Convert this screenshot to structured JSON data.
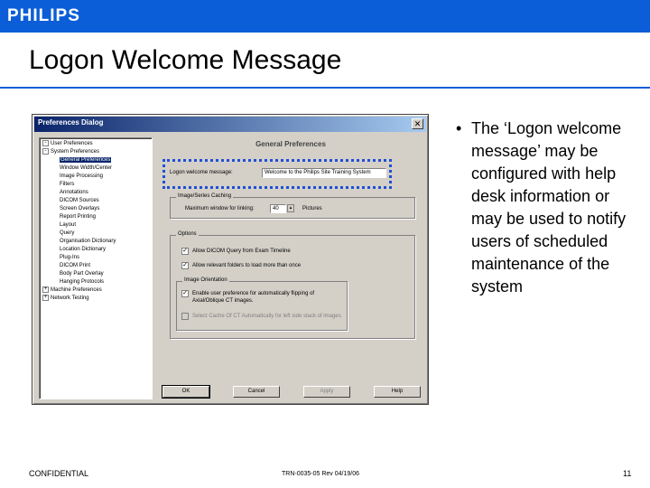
{
  "header": {
    "logo": "PHILIPS"
  },
  "slide": {
    "title": "Logon Welcome Message"
  },
  "dialog": {
    "title": "Preferences Dialog",
    "close_glyph": "✕",
    "tree": [
      {
        "label": "User Preferences",
        "expander": "-",
        "level": 0
      },
      {
        "label": "System Preferences",
        "expander": "-",
        "level": 0
      },
      {
        "label": "General Preferences",
        "level": 2,
        "selected": true
      },
      {
        "label": "Window Width/Center",
        "level": 2
      },
      {
        "label": "Image Processing",
        "level": 2
      },
      {
        "label": "Filters",
        "level": 2
      },
      {
        "label": "Annotations",
        "level": 2
      },
      {
        "label": "DICOM Sources",
        "level": 2
      },
      {
        "label": "Screen Overlays",
        "level": 2
      },
      {
        "label": "Report Printing",
        "level": 2
      },
      {
        "label": "Layout",
        "level": 2
      },
      {
        "label": "Query",
        "level": 2
      },
      {
        "label": "Organisation Dictionary",
        "level": 2
      },
      {
        "label": "Location Dictionary",
        "level": 2
      },
      {
        "label": "Plug-Ins",
        "level": 2
      },
      {
        "label": "DICOM Print",
        "level": 2
      },
      {
        "label": "Body Part Overlay",
        "level": 2
      },
      {
        "label": "Hanging Protocols",
        "level": 2
      },
      {
        "label": "Machine Preferences",
        "expander": "+",
        "level": 0
      },
      {
        "label": "Network Testing",
        "expander": "+",
        "level": 0
      }
    ],
    "panel": {
      "heading": "General Preferences",
      "logon_label": "Logon welcome message:",
      "logon_value": "Welcome to the Philips Site Training System",
      "image_group_title": "Image/Series Caching",
      "max_label": "Maximum window for linking:",
      "max_value": "40",
      "max_unit": "Pictures",
      "options_title": "Options",
      "opt1": "Allow DICOM Query from Exam Timeline",
      "opt2": "Allow relevant folders to load more than once",
      "orientation_title": "Image Orientation",
      "opt3": "Enable user preference for automatically flipping of Axial/Oblique CT images.",
      "opt4": "Select Cache Of CT Automatically for left side stack of images."
    },
    "buttons": {
      "ok": "OK",
      "cancel": "Cancel",
      "apply": "Apply",
      "help": "Help"
    }
  },
  "bullet": {
    "marker": "•",
    "text": "The ‘Logon welcome message’ may be configured with help desk information or may be used to notify users of scheduled maintenance of the system"
  },
  "footer": {
    "confidential": "CONFIDENTIAL",
    "doc_id": "TRN-0035-05 Rev 04/19/06",
    "page": "11"
  },
  "colors": {
    "brand_blue": "#0b5ed7",
    "highlight_border": "#1f4fd6",
    "dialog_face": "#d4d0c8"
  }
}
